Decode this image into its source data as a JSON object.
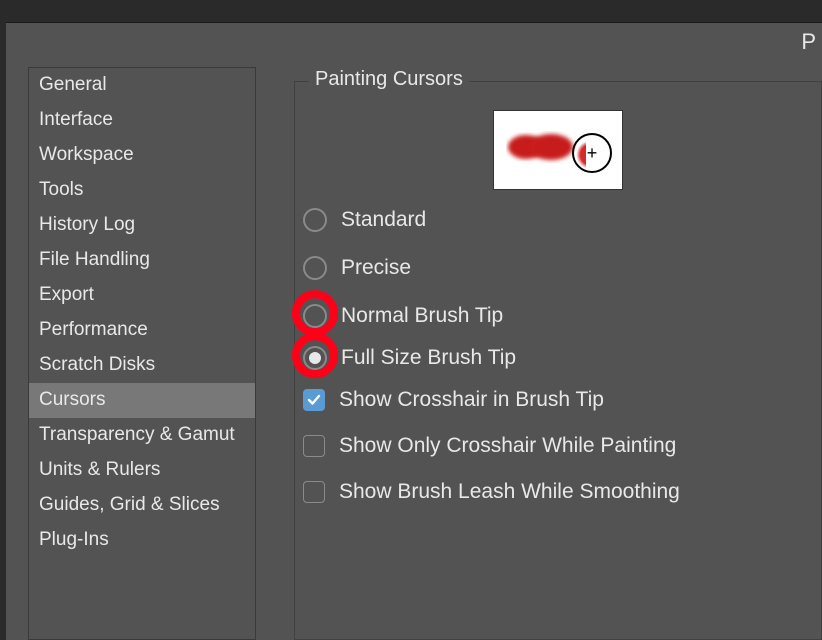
{
  "window": {
    "titleFragment": "P"
  },
  "sidebar": {
    "items": [
      {
        "label": "General",
        "selected": false
      },
      {
        "label": "Interface",
        "selected": false
      },
      {
        "label": "Workspace",
        "selected": false
      },
      {
        "label": "Tools",
        "selected": false
      },
      {
        "label": "History Log",
        "selected": false
      },
      {
        "label": "File Handling",
        "selected": false
      },
      {
        "label": "Export",
        "selected": false
      },
      {
        "label": "Performance",
        "selected": false
      },
      {
        "label": "Scratch Disks",
        "selected": false
      },
      {
        "label": "Cursors",
        "selected": true
      },
      {
        "label": "Transparency & Gamut",
        "selected": false
      },
      {
        "label": "Units & Rulers",
        "selected": false
      },
      {
        "label": "Guides, Grid & Slices",
        "selected": false
      },
      {
        "label": "Plug-Ins",
        "selected": false
      }
    ]
  },
  "paintingCursors": {
    "groupTitle": "Painting Cursors",
    "radios": [
      {
        "label": "Standard",
        "checked": false,
        "highlighted": false
      },
      {
        "label": "Precise",
        "checked": false,
        "highlighted": false
      },
      {
        "label": "Normal Brush Tip",
        "checked": false,
        "highlighted": true
      },
      {
        "label": "Full Size Brush Tip",
        "checked": true,
        "highlighted": true
      }
    ],
    "checkboxes": [
      {
        "label": "Show Crosshair in Brush Tip",
        "checked": true
      },
      {
        "label": "Show Only Crosshair While Painting",
        "checked": false
      },
      {
        "label": "Show Brush Leash While Smoothing",
        "checked": false
      }
    ],
    "previewCrosshair": "+"
  },
  "annotation": {
    "highlightColor": "#ff0019"
  }
}
